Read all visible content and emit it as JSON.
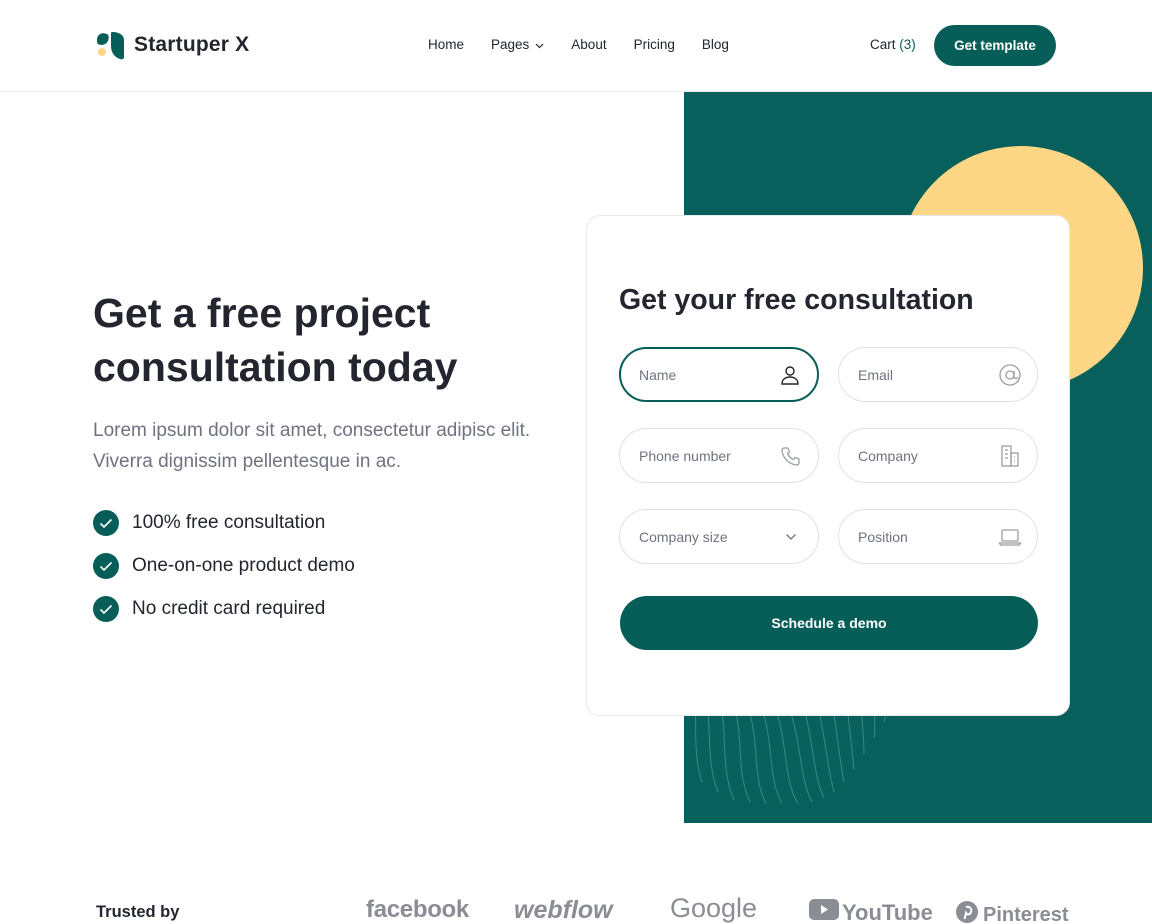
{
  "brand": {
    "name": "Startuper X",
    "logo_icon": "leaf-logo-icon"
  },
  "nav": {
    "items": [
      {
        "label": "Home"
      },
      {
        "label": "Pages",
        "has_dropdown": true
      },
      {
        "label": "About"
      },
      {
        "label": "Pricing"
      },
      {
        "label": "Blog"
      }
    ],
    "cart_label": "Cart",
    "cart_count": "(3)",
    "cta_label": "Get template"
  },
  "hero": {
    "title": "Get a free project consultation today",
    "description": "Lorem ipsum dolor sit amet, consectetur adipisc elit. Viverra dignissim pellentesque in ac.",
    "features": [
      "100% free consultation",
      "One-on-one product demo",
      "No credit card required"
    ]
  },
  "form": {
    "title": "Get your free consultation",
    "fields": {
      "name": {
        "placeholder": "Name",
        "icon": "user-icon"
      },
      "email": {
        "placeholder": "Email",
        "icon": "at-sign-icon"
      },
      "phone": {
        "placeholder": "Phone number",
        "icon": "phone-icon"
      },
      "company": {
        "placeholder": "Company",
        "icon": "building-icon"
      },
      "company_size": {
        "placeholder": "Company size",
        "icon": "chevron-down-icon"
      },
      "position": {
        "placeholder": "Position",
        "icon": "laptop-icon"
      }
    },
    "submit_label": "Schedule a demo"
  },
  "trusted": {
    "label": "Trusted by",
    "brands": [
      "facebook",
      "webflow",
      "Google",
      "YouTube",
      "Pinterest"
    ]
  },
  "colors": {
    "primary": "#075e58",
    "accent": "#fdd786",
    "text": "#23262f",
    "muted": "#6f7380"
  }
}
